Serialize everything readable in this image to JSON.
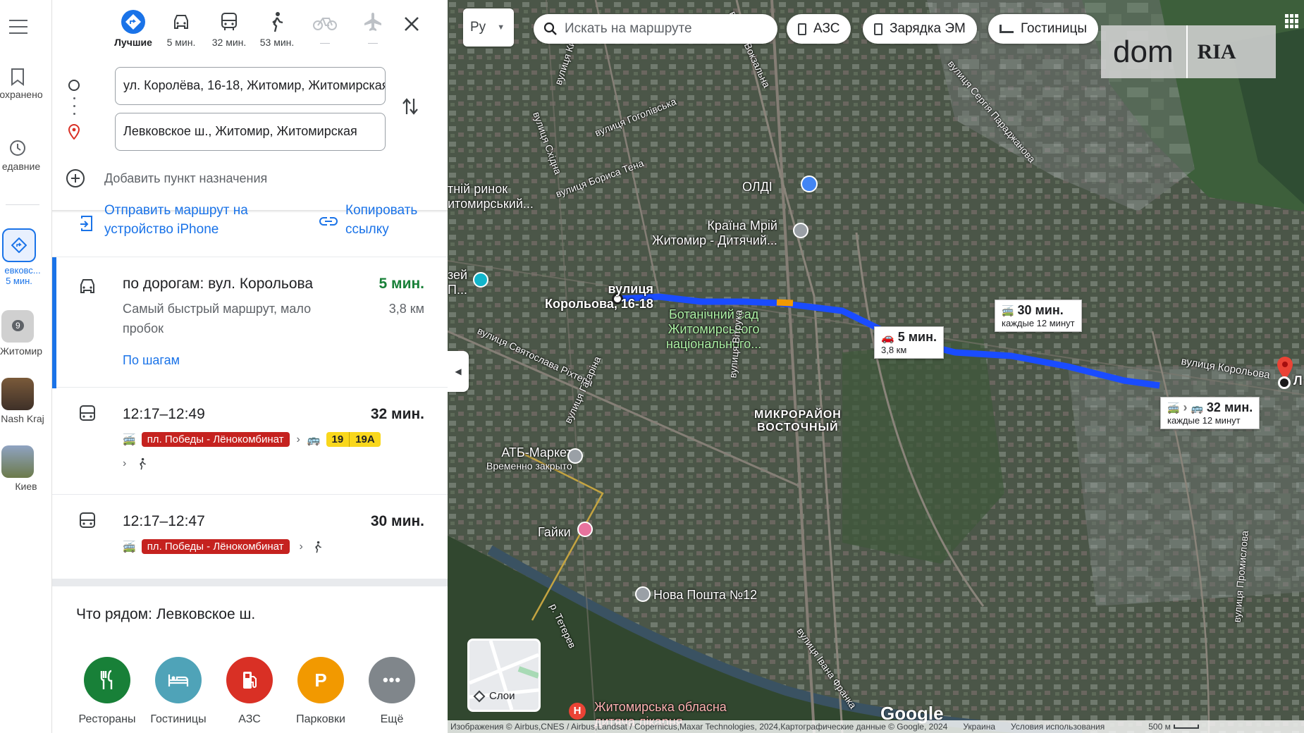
{
  "rail": {
    "saved": "охранено",
    "recent": "едавние",
    "dest_name": "евковс...",
    "dest_time": "5 мин.",
    "zhytomyr_count": "9",
    "zhytomyr": "Житомир",
    "nashkraj": "Nash Kraj",
    "kiev": "Киев"
  },
  "modes": [
    {
      "label": "Лучшие",
      "icon": "best-route-icon"
    },
    {
      "label": "5 мин.",
      "icon": "car-icon"
    },
    {
      "label": "32 мин.",
      "icon": "transit-icon"
    },
    {
      "label": "53 мин.",
      "icon": "walk-icon"
    },
    {
      "label": "—",
      "icon": "bicycle-icon"
    },
    {
      "label": "—",
      "icon": "plane-icon"
    }
  ],
  "origin_value": "ул. Королёва, 16-18, Житомир, Житомирская",
  "destination_value": "Левковское ш., Житомир, Житомирская",
  "add_destination": "Добавить пункт назначения",
  "send_to_phone_1": "Отправить маршрут на",
  "send_to_phone_2": "устройство iPhone",
  "copy_link_1": "Копировать",
  "copy_link_2": "ссылку",
  "routes": {
    "car": {
      "title": "по дорогам: вул. Корольова",
      "duration": "5 мин.",
      "desc_1": "Самый быстрый маршрут, мало",
      "desc_2": "пробок",
      "distance": "3,8 км",
      "steps": "По шагам"
    },
    "transit1": {
      "time": "12:17–12:49",
      "duration": "32 мин.",
      "line": "пл. Победы - Лёнокомбинат",
      "bus_a": "19",
      "bus_b": "19A"
    },
    "transit2": {
      "time": "12:17–12:47",
      "duration": "30 мин.",
      "line": "пл. Победы - Лёнокомбинат"
    }
  },
  "nearby_title": "Что рядом: Левковское ш.",
  "nearby": [
    {
      "label": "Рестораны",
      "color": "#188038"
    },
    {
      "label": "Гостиницы",
      "color": "#4fa3b8"
    },
    {
      "label": "АЗС",
      "color": "#d93025"
    },
    {
      "label": "Парковки",
      "color": "#f29900"
    },
    {
      "label": "Ещё",
      "color": "#80868b"
    }
  ],
  "map": {
    "layer_short": "Ру",
    "search_placeholder": "Искать на маршруте",
    "chip_fuel": "АЗС",
    "chip_ev": "Зарядка ЭМ",
    "chip_hotels": "Гостиницы",
    "watermark_a": "dom",
    "watermark_b": "RIA",
    "layers": "Слои",
    "google": "Google",
    "origin_1": "вулиця",
    "origin_2": "Корольова, 16-18",
    "tip_car_time": "5 мин.",
    "tip_car_dist": "3,8 км",
    "tip_t30": "30 мин.",
    "tip_t30_sub": "каждые 12 минут",
    "tip_t32": "32 мин.",
    "tip_t32_sub": "каждые 12 минут",
    "labels": {
      "market_1": "тній ринок",
      "market_2": "итомирський...",
      "museum_1": "зей",
      "museum_2": "П...",
      "oldi": "ОЛДІ",
      "kraina_1": "Країна Мрій",
      "kraina_2": "Житомир - Дитячий...",
      "botanic_1": "Ботанічний сад",
      "botanic_2": "Житомирського",
      "botanic_3": "національного...",
      "micro_1": "МИКРОРАЙОН",
      "micro_2": "ВОСТОЧНЫЙ",
      "atb_1": "АТБ-Маркет",
      "atb_2": "Временно закрыто",
      "gaiky": "Гайки",
      "nova": "Нова Пошта №12",
      "oblast_1": "Житомирська обласна",
      "oblast_2": "дитяча лікарня",
      "korolova_st": "вулиця Корольова",
      "street_kyivska": "вулиця Київська",
      "street_gogol": "вулиця Гоголівська",
      "street_skydna": "вулиця Східна",
      "street_vokzalna": "вулиця Вокзальна",
      "street_tena": "вулиця Бориса Тена",
      "street_paradzhanova": "вулиця Сергія Параджанова",
      "street_rikhter": "вулиця Святослава Ріхтера",
      "street_gagarina": "вулиця Гагаріна",
      "street_vitruka": "вулиця Вітрука",
      "street_promyslova": "вулиця Промислова",
      "street_teteriv": "р. Тетерев",
      "street_franka": "вулиця Івана Франка",
      "end_l": "Л"
    },
    "attribution": "Изображения © Airbus,CNES / Airbus,Landsat / Copernicus,Maxar Technologies, 2024,Картографические данные © Google, 2024",
    "country": "Украина",
    "terms": "Условия использования",
    "scale": "500 м"
  }
}
